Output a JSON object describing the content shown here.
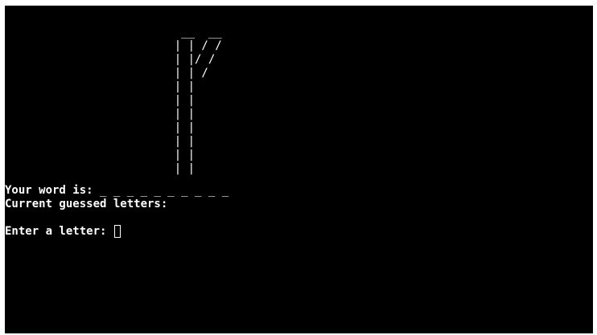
{
  "terminal": {
    "background_color": "#000000",
    "text_color": "#ffffff",
    "gallows_art": "                          __  __\n                         | | / /\n                         | |/ /\n                         | | /\n                         | |\n                         | |\n                         | |\n                         | |\n                         | |\n                         | |\n                         | |",
    "word_label": "Your word is:",
    "word_blanks": "_ _ _ _ _ _ _ _ _ _",
    "guessed_label": "Current guessed letters:",
    "guessed_value": "",
    "prompt_label": "Enter a letter:"
  }
}
